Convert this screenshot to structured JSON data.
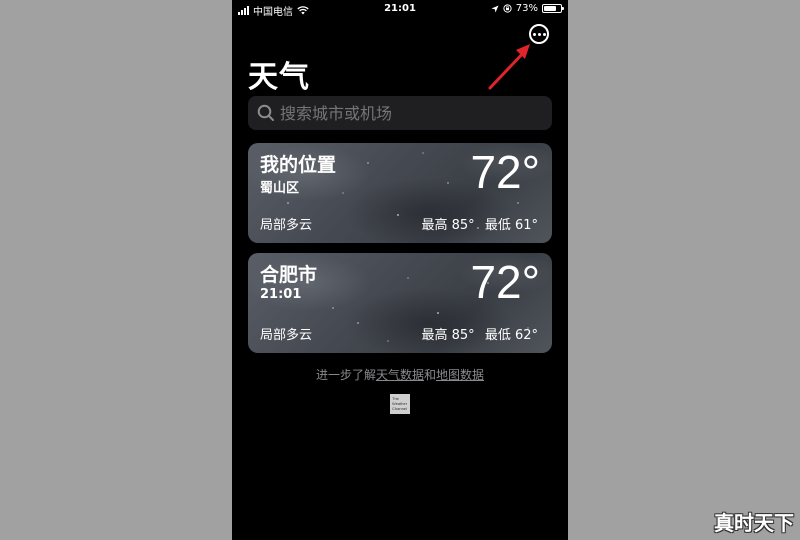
{
  "status_bar": {
    "carrier": "中国电信",
    "time": "21:01",
    "battery": "73%",
    "battery_level": 0.73,
    "icons": [
      "signal-icon",
      "wifi-icon",
      "location-icon",
      "rotation-lock-icon",
      "battery-icon"
    ]
  },
  "header": {
    "title": "天气",
    "more_icon": "ellipsis-circle-icon",
    "annotation": "red-arrow"
  },
  "search": {
    "placeholder": "搜索城市或机场",
    "icon": "search-icon"
  },
  "cities": [
    {
      "name": "我的位置",
      "sub": "蜀山区",
      "temp": "72°",
      "condition": "局部多云",
      "high": "最高 85°",
      "low": "最低 61°"
    },
    {
      "name": "合肥市",
      "sub": "21:01",
      "temp": "72°",
      "condition": "局部多云",
      "high": "最高 85°",
      "low": "最低 62°"
    }
  ],
  "footer": {
    "prefix": "进一步了解",
    "link1": "天气数据",
    "middle": "和",
    "link2": "地图数据",
    "logo_lines": [
      "The",
      "Weather",
      "Channel"
    ]
  },
  "watermark": "真时天下",
  "colors": {
    "background": "#a1a1a1",
    "screen": "#000000",
    "search_bg": "#1f1f21",
    "annotation_red": "#e0242b"
  }
}
